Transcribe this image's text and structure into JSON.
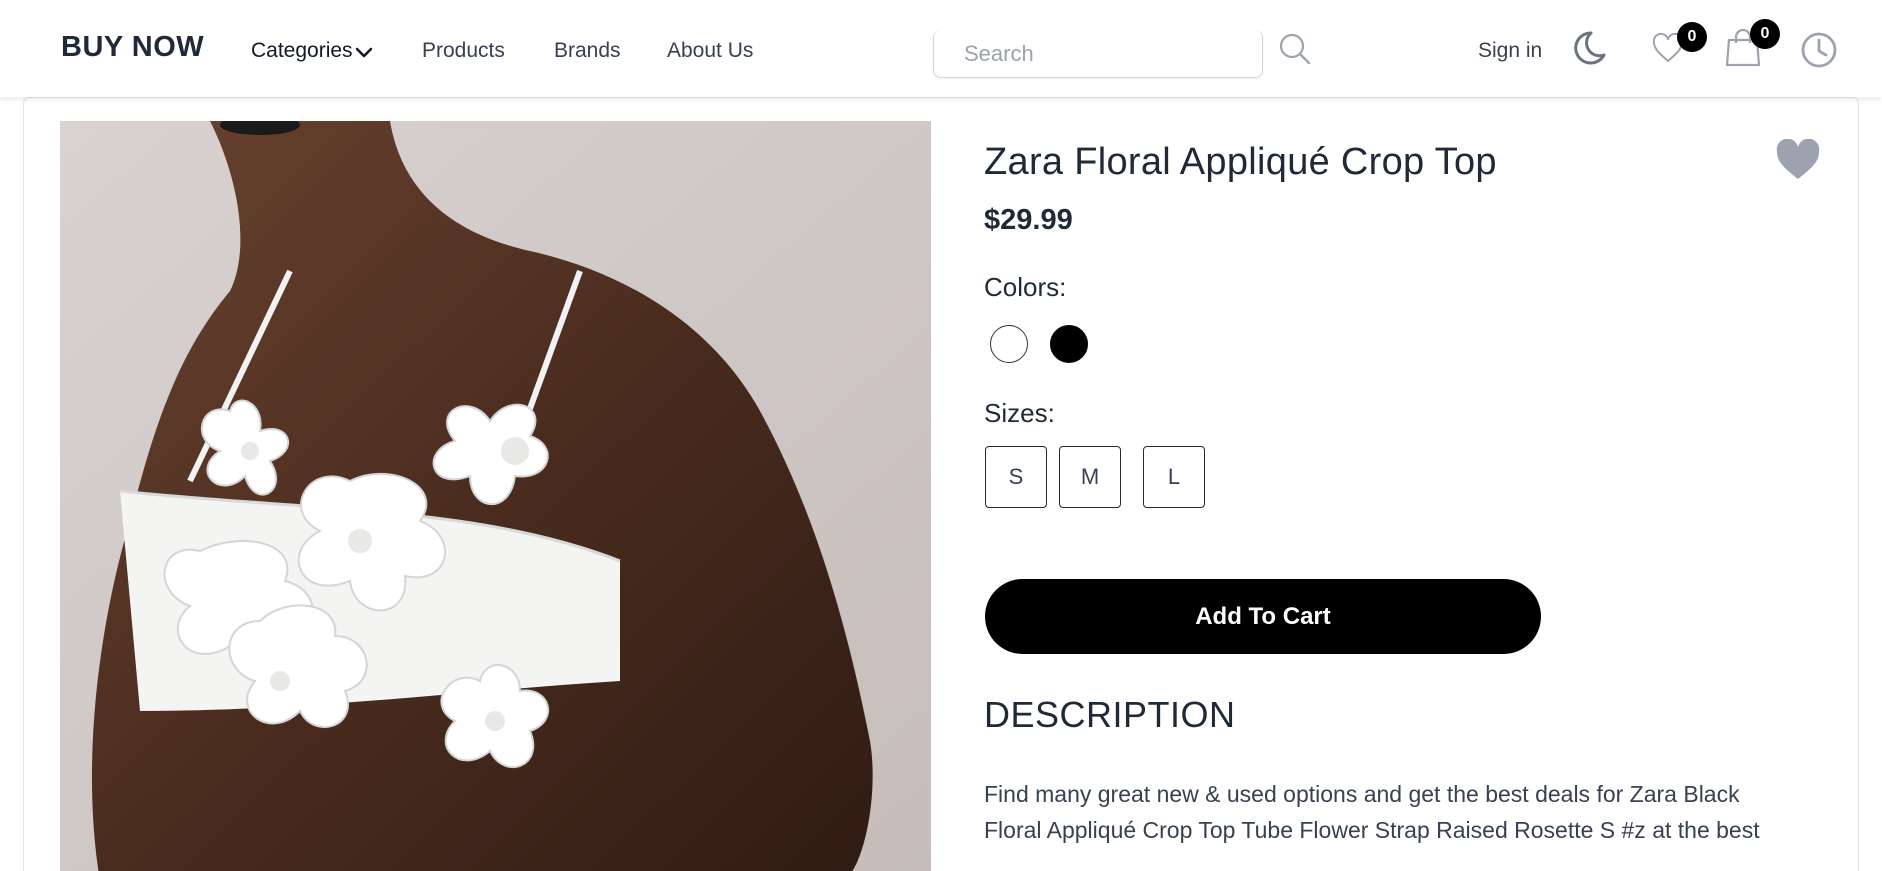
{
  "header": {
    "logo": "BUY NOW",
    "nav": {
      "categories": "Categories",
      "products": "Products",
      "brands": "Brands",
      "about": "About Us"
    },
    "search": {
      "placeholder": "Search",
      "value": ""
    },
    "sign_in": "Sign in",
    "wishlist_count": "0",
    "cart_count": "0",
    "icons": [
      "chevron-down-icon",
      "search-icon",
      "moon-icon",
      "heart-icon",
      "shopping-bag-icon",
      "clock-icon"
    ]
  },
  "product": {
    "title": "Zara Floral Appliqué Crop Top",
    "price": "$29.99",
    "colors_label": "Colors:",
    "colors": [
      "#ffffff",
      "#000000"
    ],
    "sizes_label": "Sizes:",
    "sizes": [
      "S",
      "M",
      "L"
    ],
    "add_to_cart": "Add To Cart",
    "favorite_icon": "heart-filled-icon",
    "favorite_color": "#9ca3af"
  },
  "description": {
    "heading": "DESCRIPTION",
    "text": "Find many great new & used options and get the best deals for Zara Black Floral Appliqué Crop Top Tube Flower Strap Raised Rosette S #z at the best"
  },
  "colors": {
    "text_primary": "#1f2937",
    "button_bg": "#000000",
    "button_text": "#ffffff"
  }
}
